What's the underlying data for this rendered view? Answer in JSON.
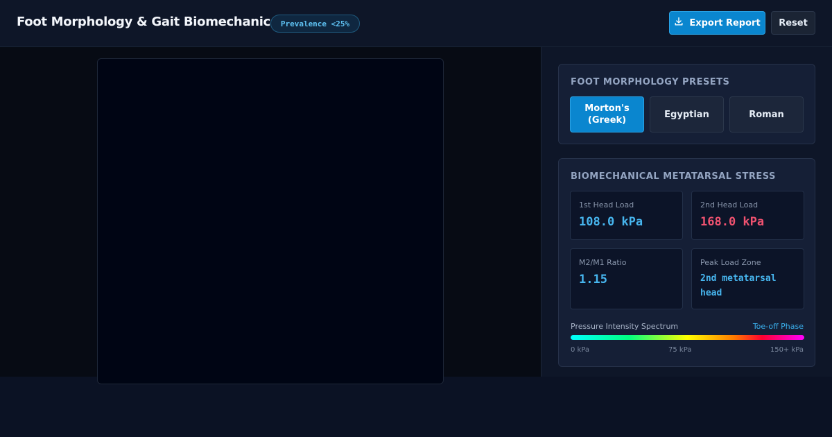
{
  "header": {
    "title": "Foot Morphology & Gait Biomechanics",
    "badge": "Prevalence <25%",
    "export_label": "Export Report",
    "reset_label": "Reset"
  },
  "presets": {
    "title": "FOOT MORPHOLOGY PRESETS",
    "items": [
      {
        "label": "Morton's (Greek)",
        "active": true
      },
      {
        "label": "Egyptian",
        "active": false
      },
      {
        "label": "Roman",
        "active": false
      }
    ]
  },
  "stress": {
    "title": "BIOMECHANICAL METATARSAL STRESS",
    "metrics": [
      {
        "label": "1st Head Load",
        "value": "108.0 kPa"
      },
      {
        "label": "2nd Head Load",
        "value": "168.0 kPa"
      },
      {
        "label": "M2/M1 Ratio",
        "value": "1.15"
      },
      {
        "label": "Peak Load Zone",
        "value": "2nd metatarsal head"
      }
    ],
    "spectrum": {
      "label": "Pressure Intensity Spectrum",
      "phase": "Toe-off Phase",
      "ticks": [
        "0 kPa",
        "75 kPa",
        "150+ kPa"
      ]
    }
  },
  "colors": {
    "accent": "#0a86cf",
    "alert": "#f05270",
    "value": "#47b6ef"
  }
}
